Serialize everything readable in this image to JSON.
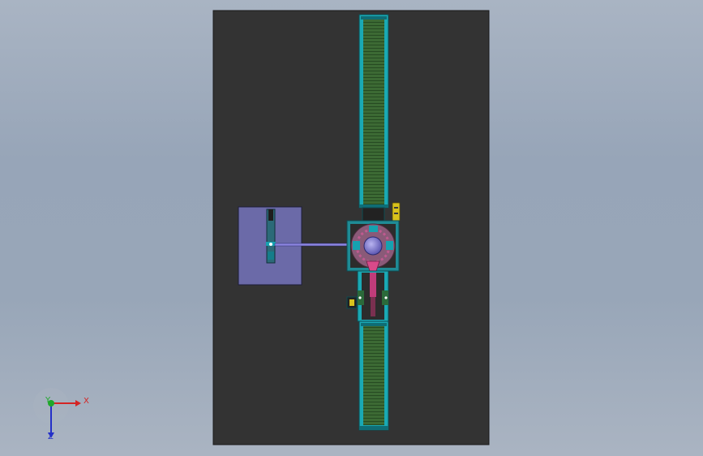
{
  "scene": {
    "background_color": "#9aa7b9",
    "base_plate_color": "#333333",
    "fixture_plate_color": "#6b6aa8",
    "conveyor_frame_color": "#1aa9b4",
    "conveyor_belt_color": "#3c6a34",
    "turntable_color": "#8a5a78",
    "center_hub_color": "#7a74c6",
    "accent_color": "#d84a8a",
    "label_tag_color": "#d8c21c"
  },
  "triad": {
    "x_label": "X",
    "y_label": "Y",
    "z_label": "Z",
    "x_color": "#d42424",
    "y_color": "#1fa82a",
    "z_color": "#2430c8"
  }
}
